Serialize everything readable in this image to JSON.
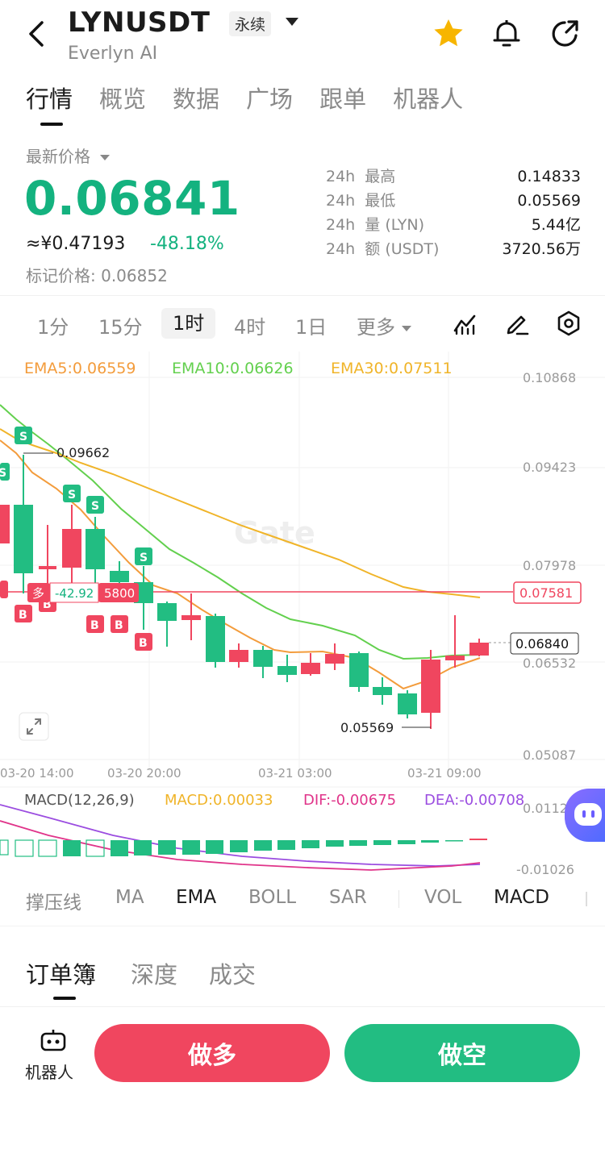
{
  "header": {
    "pair": "LYNUSDT",
    "contract_type": "永续",
    "subtitle": "Everlyn AI",
    "icons": [
      "back-arrow-icon",
      "star-icon",
      "bell-icon",
      "share-icon"
    ]
  },
  "tabs": [
    {
      "label": "行情",
      "active": true
    },
    {
      "label": "概览",
      "active": false
    },
    {
      "label": "数据",
      "active": false
    },
    {
      "label": "广场",
      "active": false
    },
    {
      "label": "跟单",
      "active": false
    },
    {
      "label": "机器人",
      "active": false
    }
  ],
  "price": {
    "label": "最新价格",
    "last": "0.06841",
    "cny": "≈¥0.47193",
    "change": "-48.18%",
    "mark_price": "标记价格: 0.06852"
  },
  "stats": [
    {
      "label": "24h  最高",
      "value": "0.14833"
    },
    {
      "label": "24h  最低",
      "value": "0.05569"
    },
    {
      "label": "24h  量 (LYN)",
      "value": "5.44亿"
    },
    {
      "label": "24h  额 (USDT)",
      "value": "3720.56万"
    }
  ],
  "intervals": [
    {
      "label": "1分",
      "active": false
    },
    {
      "label": "15分",
      "active": false
    },
    {
      "label": "1时",
      "active": true
    },
    {
      "label": "4时",
      "active": false
    },
    {
      "label": "1日",
      "active": false
    },
    {
      "label": "更多",
      "active": false
    }
  ],
  "toolbar_icons": [
    "indicator-icon",
    "draw-pen-icon",
    "settings-icon"
  ],
  "ema": {
    "ema5": "EMA5:0.06559",
    "ema10": "EMA10:0.06626",
    "ema30": "EMA30:0.07511",
    "colors": {
      "ema5": "#f39c3c",
      "ema10": "#63d04e",
      "ema30": "#f0b429"
    }
  },
  "chart_data": {
    "type": "candlestick",
    "y_axis_labels": [
      "0.10868",
      "0.09423",
      "0.07978",
      "0.06532",
      "0.05087"
    ],
    "x_axis_labels": [
      "03-20 14:00",
      "03-20 20:00",
      "03-21 03:00",
      "03-21 09:00"
    ],
    "high_marker": "0.09662",
    "low_marker": "0.05569",
    "position_line": {
      "side": "多",
      "pnl": "-42.92",
      "qty": "5800",
      "price": "0.07581"
    },
    "current_price_tag": "0.06840",
    "trade_markers": [
      "S",
      "S",
      "S",
      "S",
      "S",
      "B",
      "B",
      "B",
      "B",
      "B"
    ],
    "watermark": "Gate"
  },
  "macd": {
    "title": "MACD(12,26,9)",
    "macd": "MACD:0.00033",
    "dif": "DIF:-0.00675",
    "dea": "DEA:-0.00708",
    "axis_top": "0.0112",
    "axis_bottom": "-0.01026"
  },
  "indicators": [
    {
      "label": "撑压线",
      "active": false
    },
    {
      "label": "MA",
      "active": false
    },
    {
      "label": "EMA",
      "active": true
    },
    {
      "label": "BOLL",
      "active": false
    },
    {
      "label": "SAR",
      "active": false
    },
    {
      "label": "VOL",
      "active": false
    },
    {
      "label": "MACD",
      "active": true
    }
  ],
  "order_tabs": [
    {
      "label": "订单簿",
      "active": true
    },
    {
      "label": "深度",
      "active": false
    },
    {
      "label": "成交",
      "active": false
    }
  ],
  "bottom": {
    "robot_label": "机器人",
    "long_label": "做多",
    "short_label": "做空",
    "long_color": "#f0465f",
    "short_color": "#22bd82"
  }
}
